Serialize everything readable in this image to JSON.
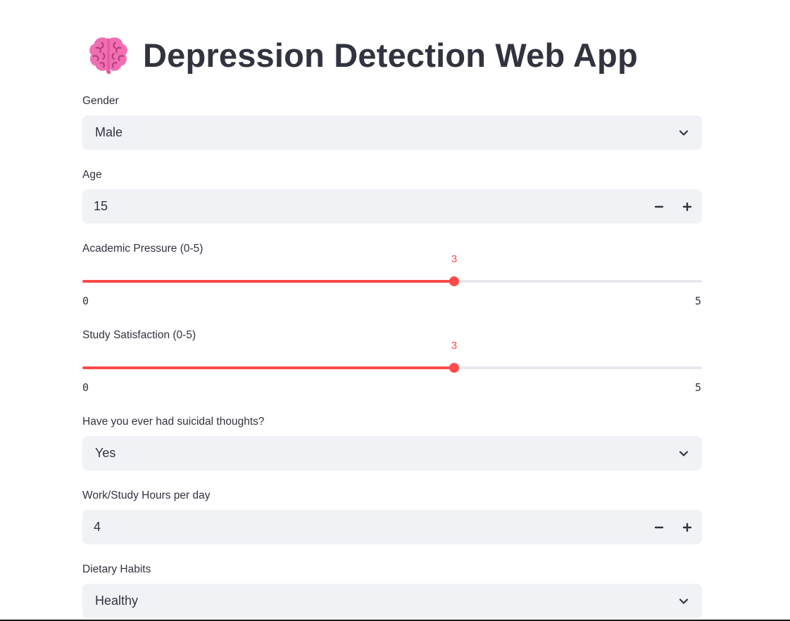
{
  "app": {
    "title": "Depression Detection Web App",
    "title_icon": "brain-icon"
  },
  "colors": {
    "accent": "#ff4b4b",
    "field_bg": "#f0f2f6",
    "text": "#31333f",
    "track": "#e6e9ef"
  },
  "form": {
    "gender": {
      "label": "Gender",
      "value": "Male"
    },
    "age": {
      "label": "Age",
      "value": "15"
    },
    "academic_pressure": {
      "label": "Academic Pressure (0-5)",
      "value": 3,
      "min": 0,
      "max": 5,
      "value_text": "3",
      "min_text": "0",
      "max_text": "5"
    },
    "study_satisfaction": {
      "label": "Study Satisfaction (0-5)",
      "value": 3,
      "min": 0,
      "max": 5,
      "value_text": "3",
      "min_text": "0",
      "max_text": "5"
    },
    "suicidal_thoughts": {
      "label": "Have you ever had suicidal thoughts?",
      "value": "Yes"
    },
    "work_study_hours": {
      "label": "Work/Study Hours per day",
      "value": "4"
    },
    "dietary_habits": {
      "label": "Dietary Habits",
      "value": "Healthy"
    }
  }
}
